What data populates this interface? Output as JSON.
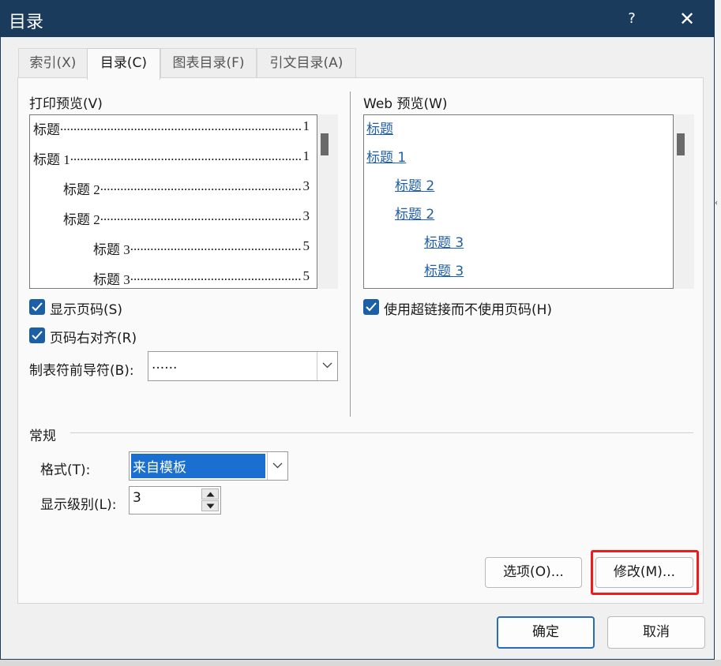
{
  "window": {
    "title": "目录",
    "help_glyph": "?",
    "close_glyph": "✕"
  },
  "tabs": [
    {
      "label": "索引(X)",
      "active": false
    },
    {
      "label": "目录(C)",
      "active": true
    },
    {
      "label": "图表目录(F)",
      "active": false
    },
    {
      "label": "引文目录(A)",
      "active": false
    }
  ],
  "print_preview": {
    "label": "打印预览(V)",
    "lines": [
      {
        "text": "标题",
        "page": "1"
      },
      {
        "text": "标题  1",
        "page": "1"
      },
      {
        "text": "标题  2",
        "page": "3"
      },
      {
        "text": "标题 2",
        "page": "3"
      },
      {
        "text": "标题  3",
        "page": "5"
      },
      {
        "text": "标题 3",
        "page": "5"
      }
    ],
    "dots": "......................................................................................................"
  },
  "web_preview": {
    "label": "Web 预览(W)",
    "lines": [
      "标题",
      "标题  1",
      "标题  2",
      "标题 2",
      "标题  3",
      "标题 3"
    ]
  },
  "options": {
    "show_page_numbers": {
      "label": "显示页码(S)",
      "checked": true
    },
    "right_align": {
      "label": "页码右对齐(R)",
      "checked": true
    },
    "tab_leader": {
      "label": "制表符前导符(B):",
      "value": "......"
    },
    "use_hyperlinks": {
      "label": "使用超链接而不使用页码(H)",
      "checked": true
    }
  },
  "general": {
    "section_label": "常规",
    "format": {
      "label": "格式(T):",
      "value": "来自模板"
    },
    "levels": {
      "label": "显示级别(L):",
      "value": "3"
    }
  },
  "buttons": {
    "options": "选项(O)...",
    "modify": "修改(M)...",
    "ok": "确定",
    "cancel": "取消"
  },
  "colors": {
    "titlebar": "#1b3b5c",
    "accent": "#1b5fa6",
    "link": "#1f5fa8",
    "highlight": "#ee1c1c"
  }
}
